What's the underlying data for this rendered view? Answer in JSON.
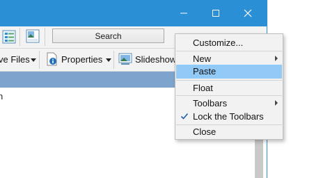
{
  "toolbar": {
    "search_label": "Search",
    "move_files_label": "ve Files",
    "properties_label": "Properties",
    "slideshow_label": "Slideshow"
  },
  "list": {
    "row1_text": "n"
  },
  "context_menu": {
    "items": [
      {
        "label": "Customize...",
        "has_submenu": false,
        "checked": false,
        "highlighted": false
      },
      {
        "label": "New",
        "has_submenu": true,
        "checked": false,
        "highlighted": false
      },
      {
        "label": "Paste",
        "has_submenu": false,
        "checked": false,
        "highlighted": true
      },
      {
        "label": "Float",
        "has_submenu": false,
        "checked": false,
        "highlighted": false
      },
      {
        "label": "Toolbars",
        "has_submenu": true,
        "checked": false,
        "highlighted": false
      },
      {
        "label": "Lock the Toolbars",
        "has_submenu": false,
        "checked": true,
        "highlighted": false
      },
      {
        "label": "Close",
        "has_submenu": false,
        "checked": false,
        "highlighted": false
      }
    ]
  },
  "colors": {
    "titlebar": "#2b8fd6",
    "menu_highlight": "#91c9f7",
    "header_band": "#7da4cc"
  },
  "icons": [
    "minimize-icon",
    "maximize-icon",
    "close-icon",
    "list-view-icon",
    "image-view-icon",
    "properties-icon",
    "slideshow-icon",
    "check-icon",
    "submenu-arrow-icon"
  ]
}
